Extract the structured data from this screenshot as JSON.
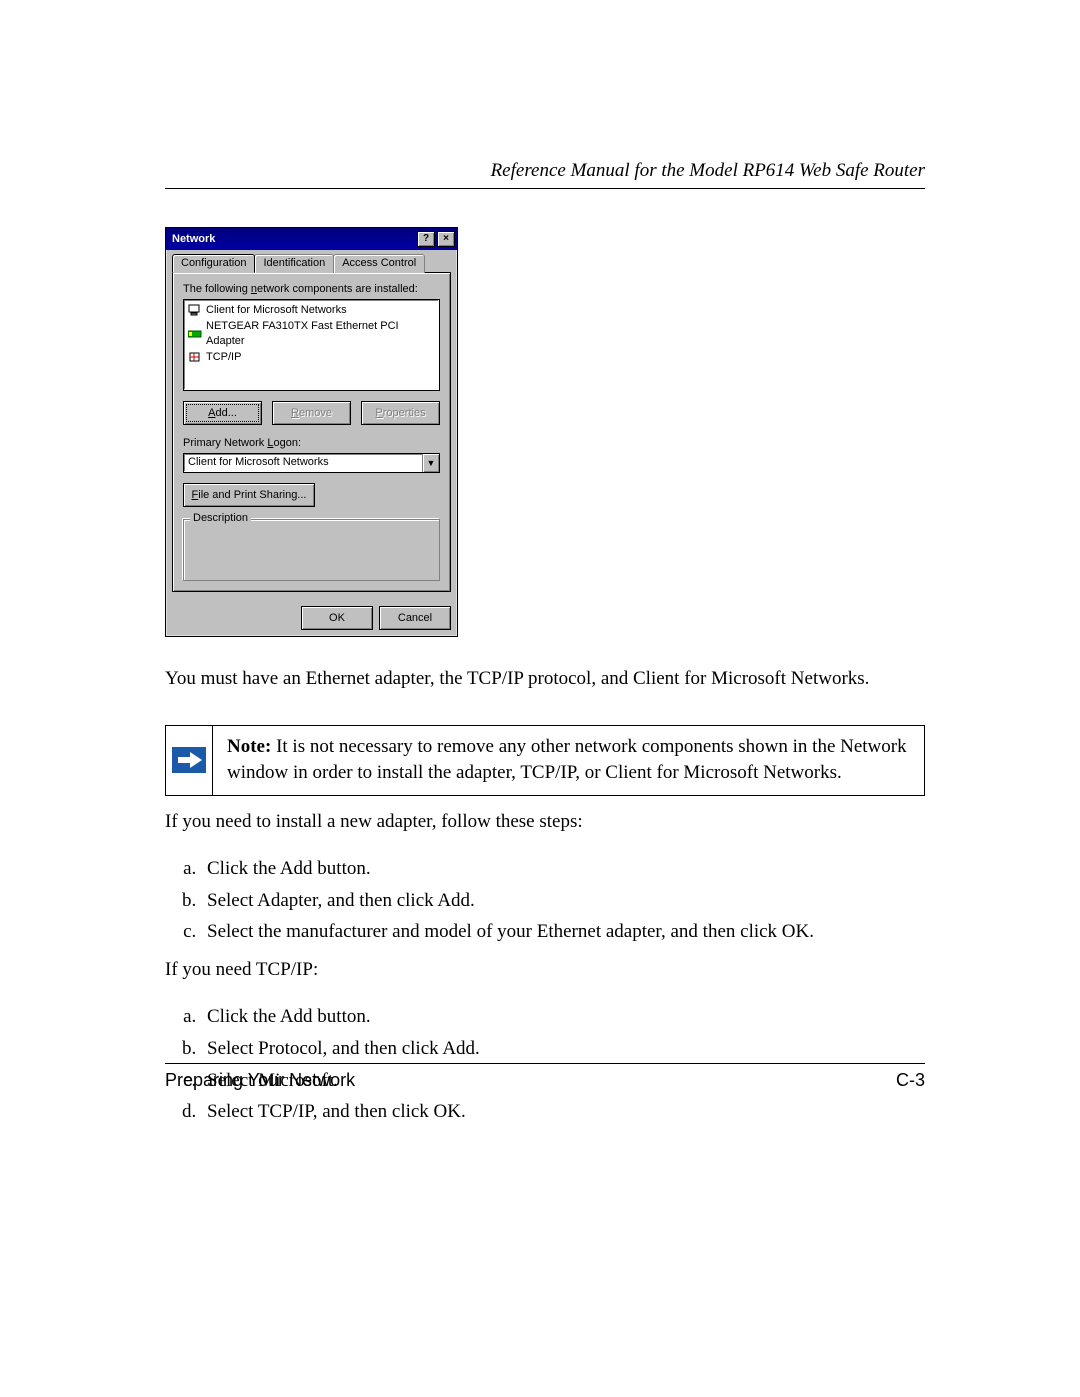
{
  "header": {
    "running_title": "Reference Manual for the Model RP614 Web Safe Router"
  },
  "dialog": {
    "title": "Network",
    "help_glyph": "?",
    "close_glyph": "×",
    "tabs": {
      "configuration": "Configuration",
      "identification": "Identification",
      "access_control": "Access Control"
    },
    "components_label_pre": "The following ",
    "components_label_underline": "n",
    "components_label_post": "etwork components are installed:",
    "components": [
      {
        "icon": "computer",
        "label": "Client for Microsoft Networks"
      },
      {
        "icon": "nic",
        "label": "NETGEAR FA310TX Fast Ethernet PCI Adapter"
      },
      {
        "icon": "proto",
        "label": "TCP/IP"
      }
    ],
    "buttons": {
      "add_u": "A",
      "add_rest": "dd...",
      "remove_u": "R",
      "remove_rest": "emove",
      "properties_u": "P",
      "properties_rest": "roperties"
    },
    "logon_label_pre": "Primary Network ",
    "logon_label_u": "L",
    "logon_label_post": "ogon:",
    "logon_value": "Client for Microsoft Networks",
    "file_sharing_u": "F",
    "file_sharing_rest": "ile and Print Sharing...",
    "description_legend": "Description",
    "ok": "OK",
    "cancel": "Cancel"
  },
  "body": {
    "para1": "You must have an Ethernet adapter, the TCP/IP protocol, and Client for Microsoft Networks.",
    "note_label": "Note:",
    "note_text": " It is not necessary to remove any other network components shown in the Network window in order to install the adapter, TCP/IP, or Client for Microsoft Networks.",
    "para2": "If you need to install a new adapter, follow these steps:",
    "list1": [
      "Click the Add button.",
      "Select Adapter, and then click Add.",
      "Select the manufacturer and model of your Ethernet adapter, and then click OK."
    ],
    "para3": "If you need TCP/IP:",
    "list2": [
      "Click the Add button.",
      "Select Protocol, and then click Add.",
      "Select Microsoft.",
      "Select TCP/IP, and then click OK."
    ]
  },
  "footer": {
    "left": "Preparing Your Network",
    "right": "C-3"
  }
}
